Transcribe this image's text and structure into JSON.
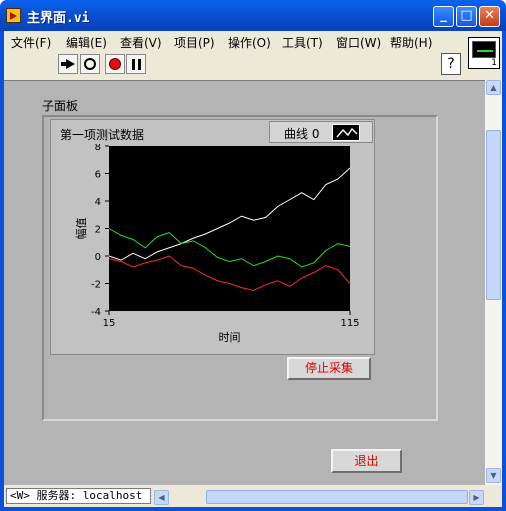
{
  "window": {
    "title": "主界面.vi",
    "minimize_glyph": "_",
    "maximize_glyph": "□",
    "close_glyph": "✕"
  },
  "menu": [
    {
      "label": "文件(F)"
    },
    {
      "label": "编辑(E)"
    },
    {
      "label": "查看(V)"
    },
    {
      "label": "项目(P)"
    },
    {
      "label": "操作(O)"
    },
    {
      "label": "工具(T)"
    },
    {
      "label": "窗口(W)"
    },
    {
      "label": "帮助(H)"
    }
  ],
  "toolbar": {
    "icons": [
      "run-arrow-icon",
      "run-continuously-icon",
      "abort-icon",
      "pause-icon"
    ],
    "help_glyph": "?"
  },
  "vi_icon": {
    "number": "1"
  },
  "panel": {
    "subpanel_label": "子面板",
    "graph": {
      "title": "第一项测试数据",
      "legend_label": "曲线 0",
      "xlabel": "时间",
      "ylabel": "幅值",
      "plot_bg": "#000000"
    },
    "stop_button": "停止采集",
    "exit_button": "退出"
  },
  "status": {
    "server_label": "<W> 服务器: localhost"
  },
  "colors": {
    "series_white": "#ffffff",
    "series_green": "#23e023",
    "series_red": "#f03020",
    "button_text": "#d80000"
  },
  "chart_data": {
    "type": "line",
    "xlabel": "时间",
    "ylabel": "幅值",
    "xlim": [
      15,
      115
    ],
    "ylim": [
      -4,
      8
    ],
    "x_ticks": [
      15,
      115
    ],
    "y_ticks": [
      -4,
      -2,
      0,
      2,
      4,
      6,
      8
    ],
    "x_start": 15,
    "x_step": 5,
    "series": [
      {
        "color": "#ffffff",
        "values": [
          0.0,
          -0.3,
          0.2,
          -0.2,
          0.3,
          0.6,
          0.9,
          1.3,
          1.6,
          2.0,
          2.4,
          2.9,
          2.6,
          2.8,
          3.6,
          4.1,
          4.6,
          4.1,
          5.2,
          5.6,
          6.4
        ]
      },
      {
        "color": "#23e023",
        "values": [
          2.0,
          1.5,
          1.2,
          0.6,
          1.4,
          1.7,
          0.9,
          1.1,
          0.6,
          -0.1,
          -0.4,
          -0.2,
          -0.7,
          -0.4,
          0.0,
          -0.2,
          -0.8,
          -0.5,
          0.4,
          0.9,
          0.7
        ]
      },
      {
        "color": "#f03020",
        "values": [
          -0.2,
          -0.4,
          -0.8,
          -0.5,
          -0.3,
          0.0,
          -0.7,
          -0.9,
          -1.4,
          -1.8,
          -2.0,
          -2.3,
          -2.5,
          -2.1,
          -1.8,
          -2.2,
          -1.6,
          -1.2,
          -0.7,
          -1.0,
          -2.0
        ]
      }
    ]
  }
}
